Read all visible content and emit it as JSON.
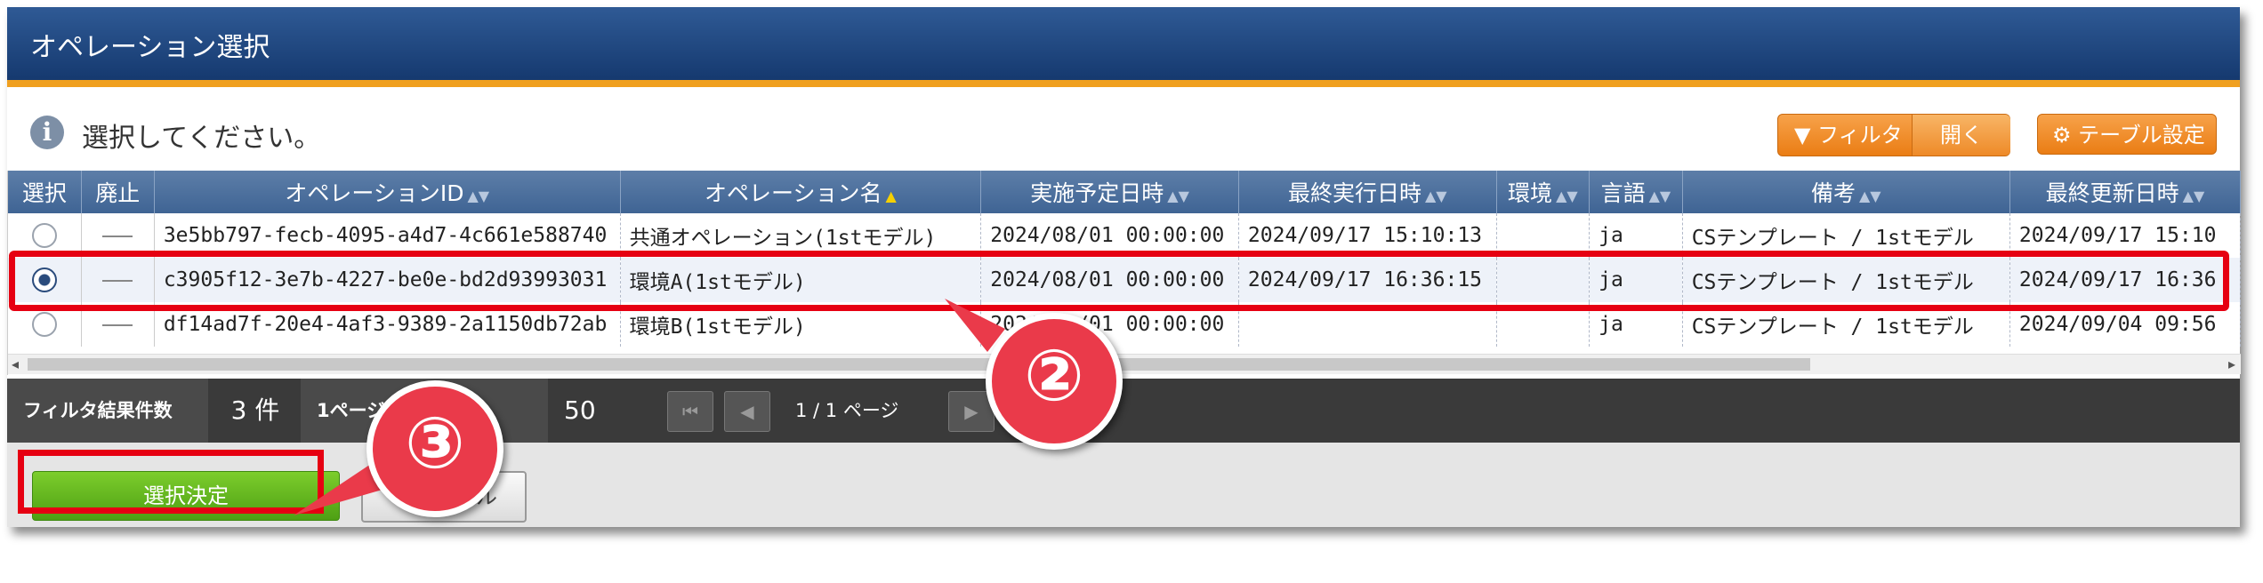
{
  "window": {
    "title": "オペレーション選択"
  },
  "info": {
    "icon": "info-icon",
    "message": "選択してください。"
  },
  "toolbar": {
    "filter_label": "フィルタ",
    "filter_toggle": "開く",
    "table_settings": "テーブル設定"
  },
  "table": {
    "columns": [
      "選択",
      "廃止",
      "オペレーションID",
      "オペレーション名",
      "実施予定日時",
      "最終実行日時",
      "環境",
      "言語",
      "備考",
      "最終更新日時"
    ],
    "rows": [
      {
        "selected": false,
        "deprecated": "—",
        "id": "3e5bb797-fecb-4095-a4d7-4c661e588740",
        "name": "共通オペレーション(1stモデル)",
        "planned": "2024/08/01 00:00:00",
        "last_run": "2024/09/17 15:10:13",
        "env": "",
        "lang": "ja",
        "note": "CSテンプレート / 1stモデル",
        "updated": "2024/09/17 15:10"
      },
      {
        "selected": true,
        "deprecated": "—",
        "id": "c3905f12-3e7b-4227-be0e-bd2d93993031",
        "name": "環境A(1stモデル)",
        "planned": "2024/08/01 00:00:00",
        "last_run": "2024/09/17 16:36:15",
        "env": "",
        "lang": "ja",
        "note": "CSテンプレート / 1stモデル",
        "updated": "2024/09/17 16:36"
      },
      {
        "selected": false,
        "deprecated": "—",
        "id": "df14ad7f-20e4-4af3-9389-2a1150db72ab",
        "name": "環境B(1stモデル)",
        "planned": "2024/08/01 00:00:00",
        "last_run": "",
        "env": "",
        "lang": "ja",
        "note": "CSテンプレート / 1stモデル",
        "updated": "2024/09/04 09:56"
      }
    ]
  },
  "pager": {
    "result_label": "フィルタ結果件数",
    "result_count": "3 件",
    "per_page_label": "1ページ表示件数",
    "per_page_value": "50",
    "page_text": "1 / 1 ページ"
  },
  "footer": {
    "ok_label": "選択決定",
    "cancel_label": "キャンセル"
  },
  "annotations": {
    "callout_2": "②",
    "callout_3": "③",
    "highlight_color": "#e60012"
  }
}
